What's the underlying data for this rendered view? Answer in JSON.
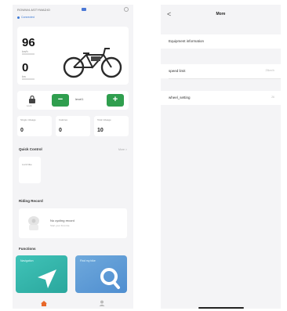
{
  "left_screen": {
    "header": {
      "device_title": "ROWW4 ASTYWADIO",
      "status_chip": "Connected"
    },
    "main_card": {
      "speed_value": "96",
      "speed_label": "km/h",
      "range_value": "0",
      "range_label": "km",
      "bike_caption": ""
    },
    "gear_control": {
      "lock_label": "Lock",
      "minus_label": "−",
      "plus_label": "+",
      "level_label": "level1"
    },
    "stats": [
      {
        "label": "Single mileage",
        "value": "0"
      },
      {
        "label": "Calories",
        "value": "0"
      },
      {
        "label": "Total mileage",
        "value": "10"
      }
    ],
    "quick_control": {
      "title": "Quick Control",
      "more_label": "More >",
      "card_label": "Lock bike"
    },
    "riding_record": {
      "title": "Riding Record",
      "empty_text": "No cycling record",
      "empty_sub": "Start your first ride"
    },
    "functions": {
      "title": "Functions",
      "cards": [
        {
          "label": "Navigation"
        },
        {
          "label": "Find my bike"
        }
      ]
    },
    "bottom_nav": {
      "items": [
        {
          "icon": "home-icon"
        },
        {
          "icon": "user-icon"
        }
      ]
    }
  },
  "right_screen": {
    "back_label": "<",
    "title": "More",
    "rows": [
      {
        "label": "Equipment information",
        "value": ""
      },
      {
        "label": "speed limit",
        "value": "25km/h"
      },
      {
        "label": "wheel_setting",
        "value": "26"
      }
    ]
  },
  "colors": {
    "accent_green": "#2f9e4e",
    "card_teal": "#40c3b8",
    "card_blue": "#6fa9dc",
    "status_blue": "#3a78d6"
  }
}
